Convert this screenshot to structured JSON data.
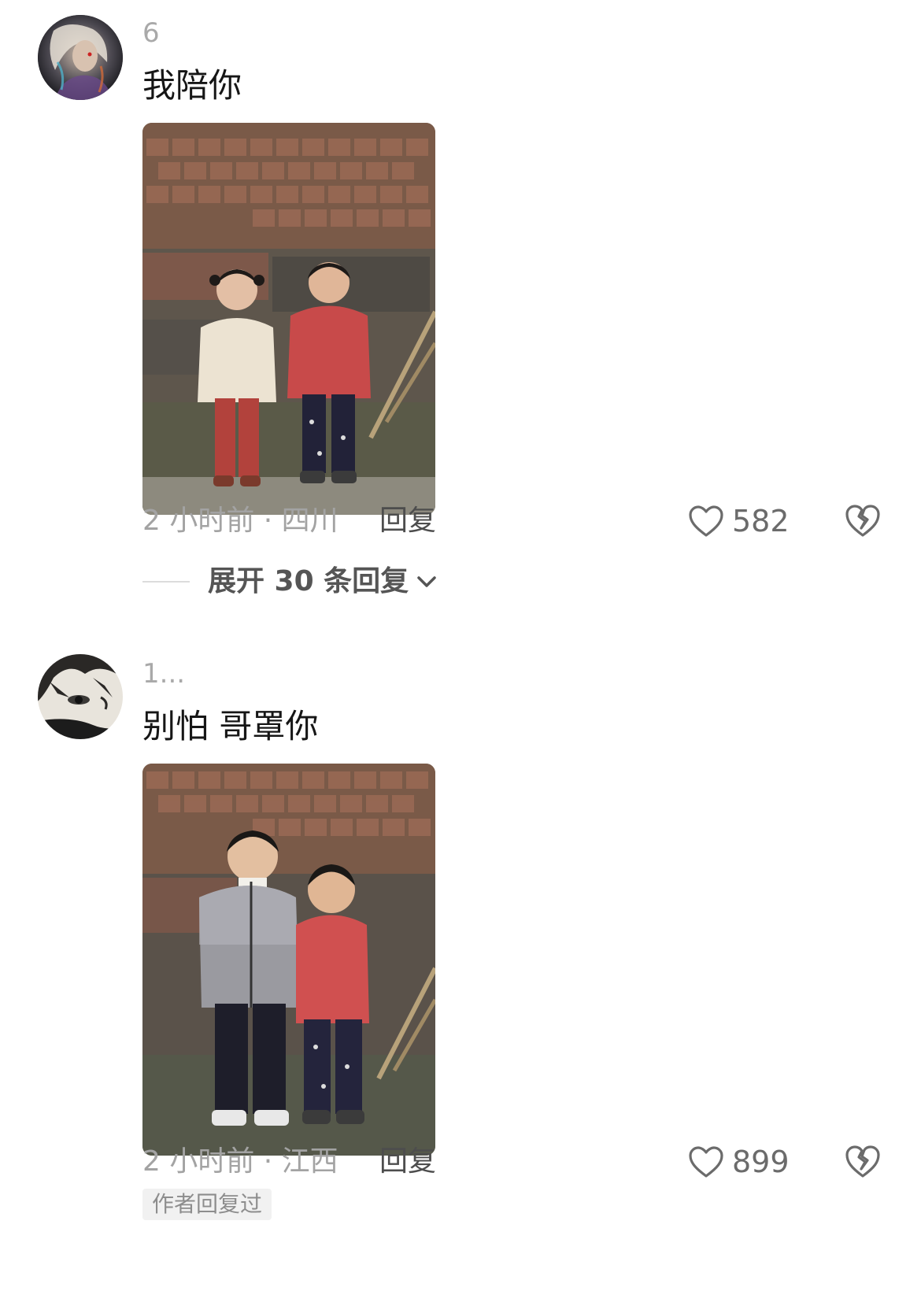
{
  "comments": [
    {
      "username": "6",
      "text": "我陪你",
      "meta": "2 小时前 · 四川",
      "reply_label": "回复",
      "like_count": "582",
      "expand_label": "展开 30 条回复",
      "avatar_icon": "anime-girl-avatar",
      "photo_description_icon": "photo-girl-and-boy"
    },
    {
      "username": "1...",
      "text": "别怕 哥罩你",
      "meta": "2 小时前 · 江西",
      "reply_label": "回复",
      "like_count": "899",
      "author_tag": "作者回复过",
      "avatar_icon": "anime-boy-avatar",
      "photo_description_icon": "photo-two-boys"
    }
  ]
}
